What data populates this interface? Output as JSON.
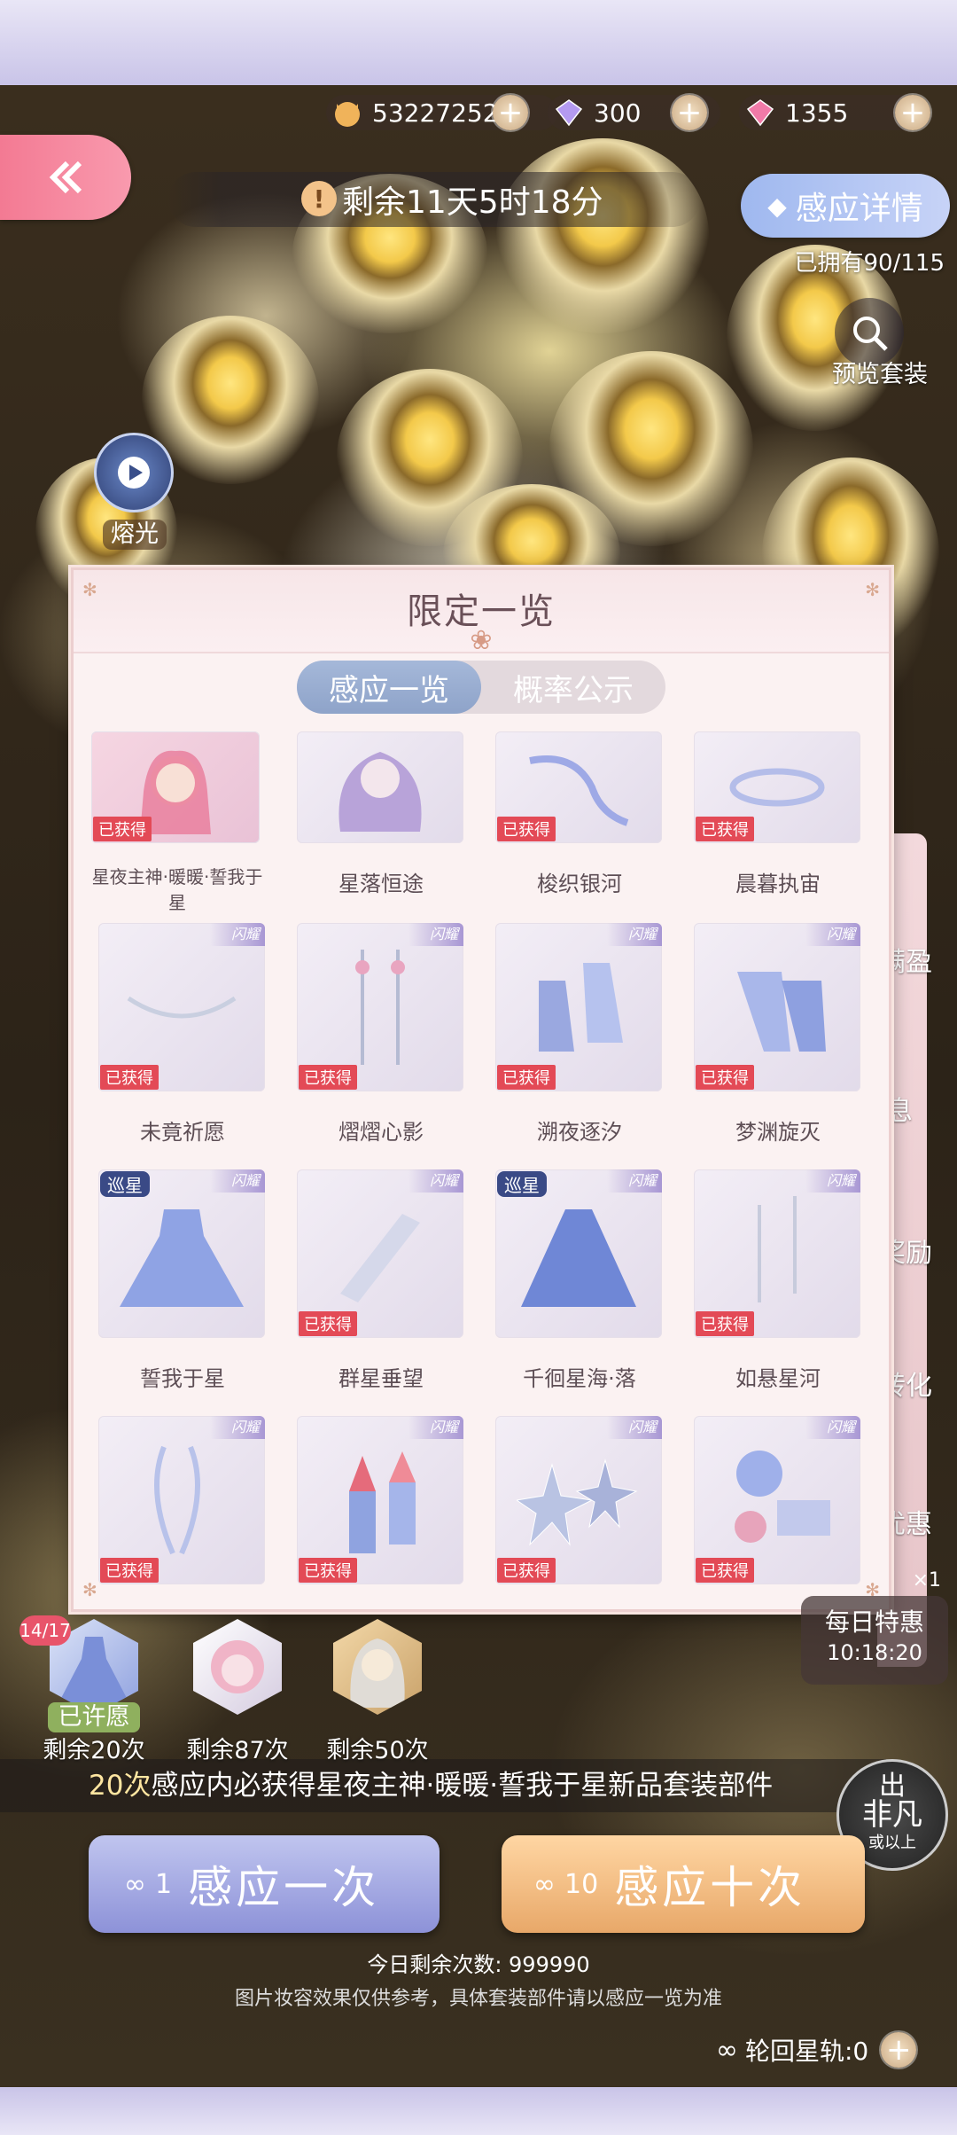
{
  "currency": [
    {
      "icon": "cat-coin-icon",
      "value": "53227252"
    },
    {
      "icon": "diamond-icon",
      "value": "300"
    },
    {
      "icon": "pink-diamond-icon",
      "value": "1355"
    }
  ],
  "timer": {
    "text": "剩余11天5时18分"
  },
  "detail_button": {
    "label": "感应详情"
  },
  "owned": {
    "text": "已拥有90/115"
  },
  "preview": {
    "label": "预览套装"
  },
  "feature": {
    "label": "熔光"
  },
  "side_menu": [
    "满盈",
    "息",
    "奖励",
    "转化",
    "优惠"
  ],
  "modal": {
    "title": "限定一览",
    "tabs": [
      "感应一览",
      "概率公示"
    ],
    "obtained_label": "已获得",
    "flag_label": "闪耀",
    "star_label": "巡星",
    "items_row1": [
      "星夜主神·暖暖·誓我于星",
      "星落恒途",
      "梭织银河",
      "晨暮执宙"
    ],
    "items_row2": [
      "未竟祈愿",
      "熠熠心影",
      "溯夜逐汐",
      "梦渊旋灭"
    ],
    "items_row3": [
      "誓我于星",
      "群星垂望",
      "千徊星海·落",
      "如悬星河"
    ]
  },
  "pools": [
    {
      "badge": "14/17",
      "status": "已许愿",
      "remaining": "剩余20次"
    },
    {
      "remaining": "剩余87次"
    },
    {
      "remaining": "剩余50次"
    }
  ],
  "daily_deal": {
    "label": "每日特惠",
    "countdown": "10:18:20",
    "multiplier": "×1"
  },
  "guarantee": {
    "prefix": "20次",
    "text": "感应内必获得星夜主神·暖暖·誓我于星新品套装部件"
  },
  "rare_badge": [
    "出",
    "非凡",
    "或以上"
  ],
  "buttons": {
    "single": {
      "cost": "1",
      "label": "感应一次"
    },
    "ten": {
      "cost": "10",
      "label": "感应十次"
    }
  },
  "today_remaining": "今日剩余次数: 999990",
  "note": "图片妆容效果仅供参考，具体套装部件请以感应一览为准",
  "orbit": "轮回星轨:0"
}
